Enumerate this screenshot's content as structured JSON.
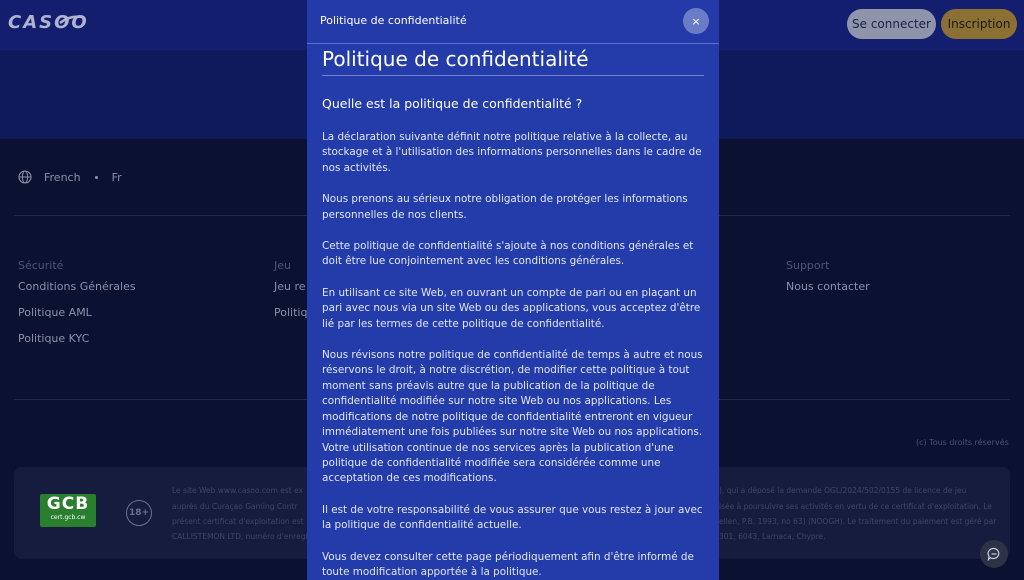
{
  "header": {
    "logo": "CASOO",
    "login_label": "Se connecter",
    "signup_label": "Inscription"
  },
  "footer": {
    "language": "French",
    "language_code": "Fr",
    "columns": [
      {
        "title": "Sécurité",
        "links": [
          "Conditions Générales",
          "Politique AML",
          "Politique KYC"
        ]
      },
      {
        "title": "Jeu",
        "links": [
          "Jeu re",
          "Politiqu"
        ]
      },
      {
        "title": "Support",
        "links": [
          "Nous contacter"
        ]
      }
    ],
    "rights": "(c) Tous droits réservés",
    "gcb_badge": "GCB",
    "gcb_site": "cert.gcb.cw",
    "age_badge": "18+",
    "license_lines_left": [
      "Le site Web www.casoo.com est ex",
      "auprès du Curaçao Gaming Contr",
      "présent certificat d'exploitation est",
      "CALLISTEMON LTD, numéro d'enregi"
    ],
    "license_lines_right": [
      "), qui a déposé la demande OGL/2024/502/0155 de licence de jeu",
      "isée à poursuivre ses activités en vertu de ce certificat d'exploitation. Le",
      "ellen, P.B. 1993, no 63) (NOOGH). Le traitement du paiement est géré par",
      "301, 6043, Larnaca, Chypre."
    ]
  },
  "modal": {
    "header_title": "Politique de confidentialité",
    "close_label": "×",
    "title": "Politique de confidentialité",
    "subtitle": "Quelle est la politique de confidentialité ?",
    "paragraphs": [
      "La déclaration suivante définit notre politique relative à la collecte, au stockage et à l'utilisation des informations personnelles dans le cadre de nos activités.",
      "Nous prenons au sérieux notre obligation de protéger les informations personnelles de nos clients.",
      "Cette politique de confidentialité s'ajoute à nos conditions générales et doit être lue conjointement avec les conditions générales.",
      "En utilisant ce site Web, en ouvrant un compte de pari ou en plaçant un pari avec nous via un site Web ou des applications, vous acceptez d'être lié par les termes de cette politique de confidentialité.",
      "Nous révisons notre politique de confidentialité de temps à autre et nous réservons le droit, à notre discrétion, de modifier cette politique à tout moment sans préavis autre que la publication de la politique de confidentialité modifiée sur notre site Web ou nos applications. Les modifications de notre politique de confidentialité entreront en vigueur immédiatement une fois publiées sur notre site Web ou nos applications. Votre utilisation continue de nos services après la publication d'une politique de confidentialité modifiée sera considérée comme une acceptation de ces modifications.",
      "Il est de votre responsabilité de vous assurer que vous restez à jour avec la politique de confidentialité actuelle.",
      "Vous devez consulter cette page périodiquement afin d'être informé de toute modification apportée à la politique."
    ]
  }
}
